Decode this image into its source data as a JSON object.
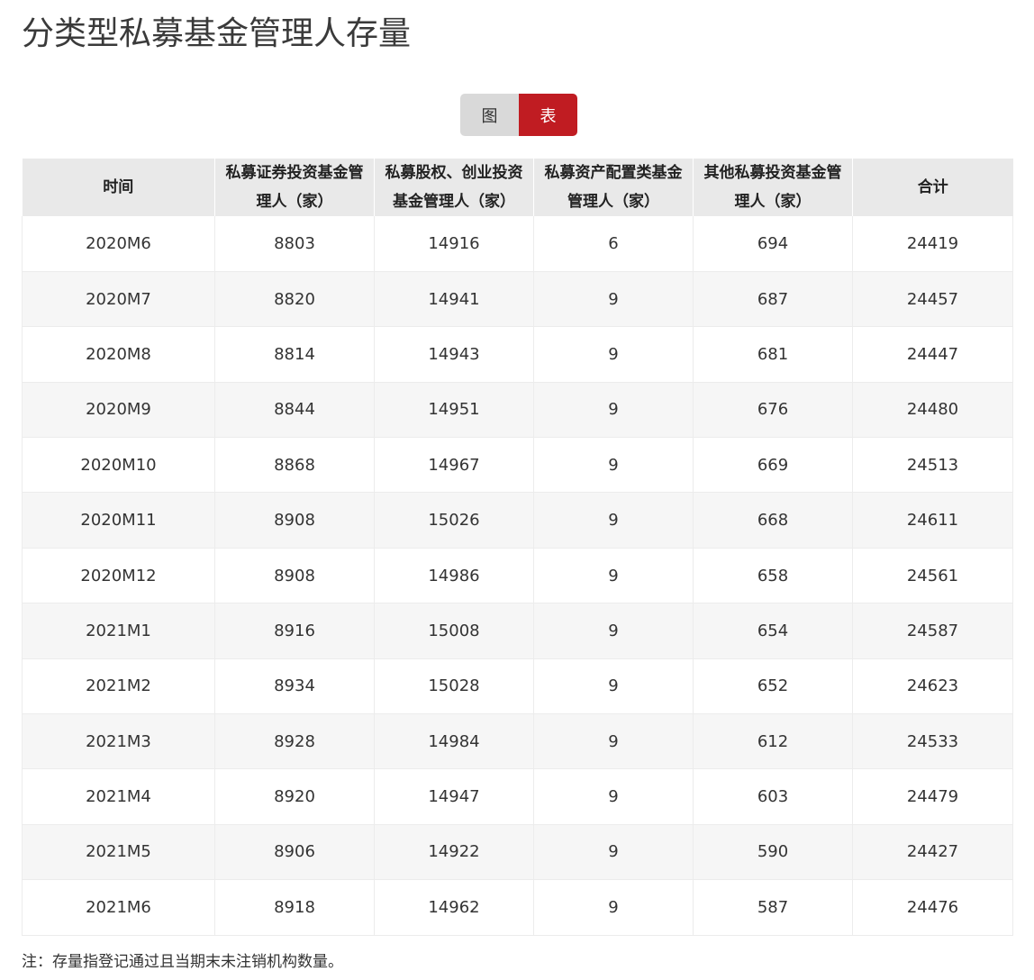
{
  "page": {
    "title": "分类型私募基金管理人存量"
  },
  "view_toggle": {
    "chart_label": "图",
    "table_label": "表",
    "active": "表"
  },
  "table": {
    "headers": [
      "时间",
      "私募证券投资基金管理人（家）",
      "私募股权、创业投资基金管理人（家）",
      "私募资产配置类基金管理人（家）",
      "其他私募投资基金管理人（家）",
      "合计"
    ],
    "rows": [
      [
        "2020M6",
        "8803",
        "14916",
        "6",
        "694",
        "24419"
      ],
      [
        "2020M7",
        "8820",
        "14941",
        "9",
        "687",
        "24457"
      ],
      [
        "2020M8",
        "8814",
        "14943",
        "9",
        "681",
        "24447"
      ],
      [
        "2020M9",
        "8844",
        "14951",
        "9",
        "676",
        "24480"
      ],
      [
        "2020M10",
        "8868",
        "14967",
        "9",
        "669",
        "24513"
      ],
      [
        "2020M11",
        "8908",
        "15026",
        "9",
        "668",
        "24611"
      ],
      [
        "2020M12",
        "8908",
        "14986",
        "9",
        "658",
        "24561"
      ],
      [
        "2021M1",
        "8916",
        "15008",
        "9",
        "654",
        "24587"
      ],
      [
        "2021M2",
        "8934",
        "15028",
        "9",
        "652",
        "24623"
      ],
      [
        "2021M3",
        "8928",
        "14984",
        "9",
        "612",
        "24533"
      ],
      [
        "2021M4",
        "8920",
        "14947",
        "9",
        "603",
        "24479"
      ],
      [
        "2021M5",
        "8906",
        "14922",
        "9",
        "590",
        "24427"
      ],
      [
        "2021M6",
        "8918",
        "14962",
        "9",
        "587",
        "24476"
      ]
    ]
  },
  "footnote": "注：存量指登记通过且当期末未注销机构数量。",
  "colors": {
    "accent": "#c01c22",
    "toggle_inactive": "#d9d9d9",
    "header_bg": "#e9e9e9",
    "row_alt_bg": "#f6f6f6"
  }
}
